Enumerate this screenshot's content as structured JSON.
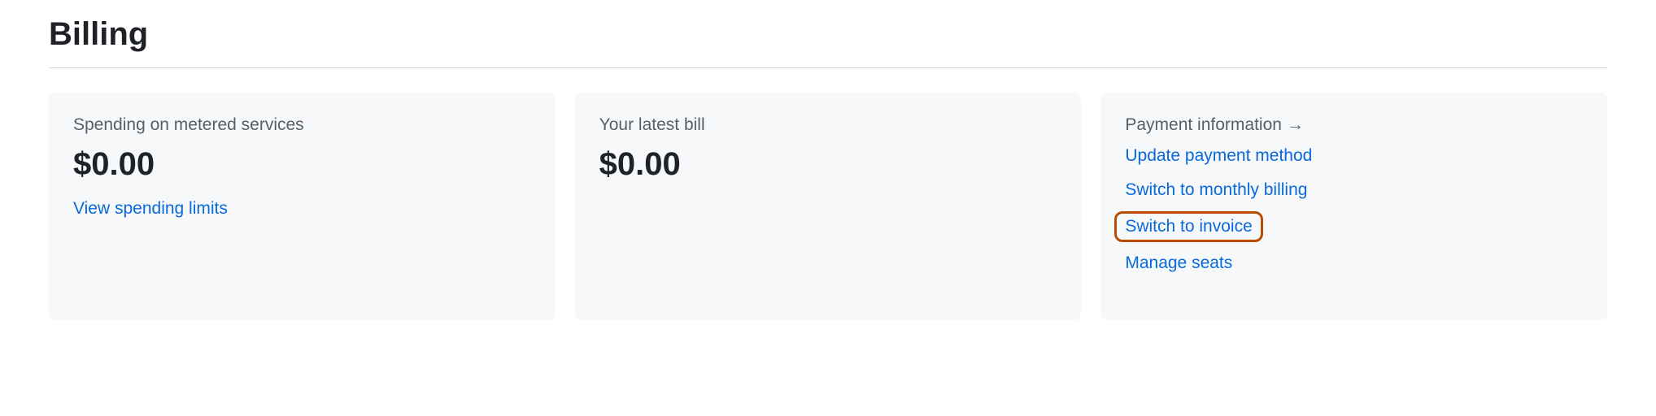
{
  "page": {
    "title": "Billing"
  },
  "cards": {
    "spending": {
      "heading": "Spending on metered services",
      "amount": "$0.00",
      "link": "View spending limits"
    },
    "latest_bill": {
      "heading": "Your latest bill",
      "amount": "$0.00"
    },
    "payment_info": {
      "heading": "Payment information",
      "links": {
        "update_payment": "Update payment method",
        "switch_monthly": "Switch to monthly billing",
        "switch_invoice": "Switch to invoice",
        "manage_seats": "Manage seats"
      }
    }
  }
}
